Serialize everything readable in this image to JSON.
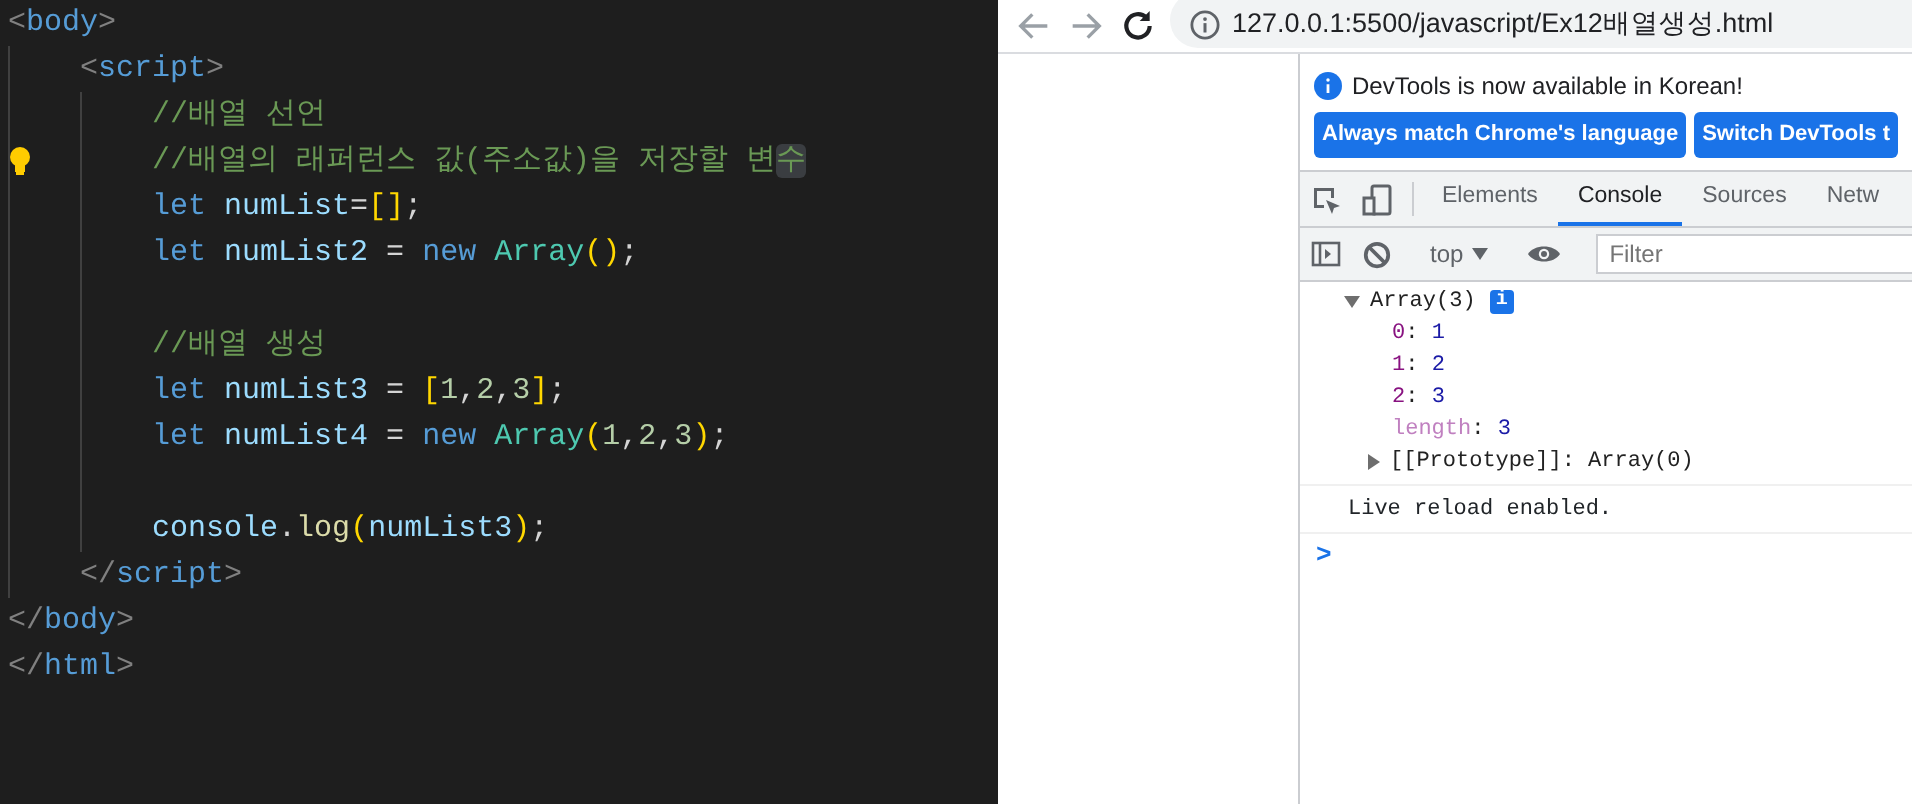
{
  "editor": {
    "lines": [
      {
        "lightbulb": false,
        "tokens": [
          {
            "text": "<",
            "kind": "tag-bracket"
          },
          {
            "text": "body",
            "kind": "tag"
          },
          {
            "text": ">",
            "kind": "tag-bracket"
          }
        ]
      },
      {
        "lightbulb": false,
        "tokens": [
          {
            "text": "    <",
            "kind": "tag-bracket"
          },
          {
            "text": "script",
            "kind": "tag"
          },
          {
            "text": ">",
            "kind": "tag-bracket"
          }
        ]
      },
      {
        "lightbulb": false,
        "tokens": [
          {
            "text": "        //배열 선언",
            "kind": "comment"
          }
        ]
      },
      {
        "lightbulb": true,
        "tokens": [
          {
            "text": "        //배열의 래퍼런스 값(주소값)을 저장할 변",
            "kind": "comment"
          },
          {
            "text": "수",
            "kind": "comment",
            "highlighted": true
          }
        ]
      },
      {
        "lightbulb": false,
        "tokens": [
          {
            "text": "        let",
            "kind": "keyword"
          },
          {
            "text": " numList",
            "kind": "variable"
          },
          {
            "text": "=",
            "kind": "operator"
          },
          {
            "text": "[]",
            "kind": "bracket"
          },
          {
            "text": ";",
            "kind": "operator"
          }
        ]
      },
      {
        "lightbulb": false,
        "tokens": [
          {
            "text": "        let",
            "kind": "keyword"
          },
          {
            "text": " numList2",
            "kind": "variable"
          },
          {
            "text": " = ",
            "kind": "operator"
          },
          {
            "text": "new",
            "kind": "keyword"
          },
          {
            "text": " Array",
            "kind": "class"
          },
          {
            "text": "()",
            "kind": "bracket"
          },
          {
            "text": ";",
            "kind": "operator"
          }
        ]
      },
      {
        "lightbulb": false
      },
      {
        "lightbulb": false,
        "tokens": [
          {
            "text": "        //배열 생성",
            "kind": "comment"
          }
        ]
      },
      {
        "lightbulb": false,
        "tokens": [
          {
            "text": "        let",
            "kind": "keyword"
          },
          {
            "text": " numList3",
            "kind": "variable"
          },
          {
            "text": " = ",
            "kind": "operator"
          },
          {
            "text": "[",
            "kind": "bracket"
          },
          {
            "text": "1",
            "kind": "number"
          },
          {
            "text": ",",
            "kind": "operator"
          },
          {
            "text": "2",
            "kind": "number"
          },
          {
            "text": ",",
            "kind": "operator"
          },
          {
            "text": "3",
            "kind": "number"
          },
          {
            "text": "]",
            "kind": "bracket"
          },
          {
            "text": ";",
            "kind": "operator"
          }
        ]
      },
      {
        "lightbulb": false,
        "tokens": [
          {
            "text": "        let",
            "kind": "keyword"
          },
          {
            "text": " numList4",
            "kind": "variable"
          },
          {
            "text": " = ",
            "kind": "operator"
          },
          {
            "text": "new",
            "kind": "keyword"
          },
          {
            "text": " Array",
            "kind": "class"
          },
          {
            "text": "(",
            "kind": "bracket"
          },
          {
            "text": "1",
            "kind": "number"
          },
          {
            "text": ",",
            "kind": "operator"
          },
          {
            "text": "2",
            "kind": "number"
          },
          {
            "text": ",",
            "kind": "operator"
          },
          {
            "text": "3",
            "kind": "number"
          },
          {
            "text": ")",
            "kind": "bracket"
          },
          {
            "text": ";",
            "kind": "operator"
          }
        ]
      },
      {
        "lightbulb": false
      },
      {
        "lightbulb": false,
        "tokens": [
          {
            "text": "        console",
            "kind": "variable"
          },
          {
            "text": ".",
            "kind": "operator"
          },
          {
            "text": "log",
            "kind": "function"
          },
          {
            "text": "(",
            "kind": "bracket"
          },
          {
            "text": "numList3",
            "kind": "variable"
          },
          {
            "text": ")",
            "kind": "bracket"
          },
          {
            "text": ";",
            "kind": "operator"
          }
        ]
      },
      {
        "lightbulb": false,
        "tokens": [
          {
            "text": "    </",
            "kind": "tag-bracket"
          },
          {
            "text": "script",
            "kind": "tag"
          },
          {
            "text": ">",
            "kind": "tag-bracket"
          }
        ]
      },
      {
        "lightbulb": false,
        "tokens": [
          {
            "text": "</",
            "kind": "tag-bracket"
          },
          {
            "text": "body",
            "kind": "tag"
          },
          {
            "text": ">",
            "kind": "tag-bracket"
          }
        ]
      },
      {
        "lightbulb": false,
        "tokens": [
          {
            "text": "</",
            "kind": "tag-bracket"
          },
          {
            "text": "html",
            "kind": "tag"
          },
          {
            "text": ">",
            "kind": "tag-bracket"
          }
        ]
      }
    ]
  },
  "browser": {
    "address": "127.0.0.1:5500/javascript/Ex12배열생성.html",
    "devtools": {
      "banner": {
        "message": "DevTools is now available in Korean!",
        "buttons": [
          "Always match Chrome's language",
          "Switch DevTools t"
        ]
      },
      "tabs": [
        {
          "label": "Elements",
          "selected": false
        },
        {
          "label": "Console",
          "selected": true
        },
        {
          "label": "Sources",
          "selected": false
        },
        {
          "label": "Netw",
          "selected": false
        }
      ],
      "context": "top",
      "filter": {
        "placeholder": "Filter"
      },
      "console": [
        {
          "kind": "object",
          "label": "Array(3)",
          "badge": "i",
          "expanded": true,
          "children": [
            {
              "kind": "index",
              "key": "0",
              "colon": ":",
              "value": "1"
            },
            {
              "kind": "index",
              "key": "1",
              "colon": ":",
              "value": "2"
            },
            {
              "kind": "index",
              "key": "2",
              "colon": ":",
              "value": "3"
            },
            {
              "kind": "meta",
              "key": "length",
              "colon": ":",
              "value": "3"
            },
            {
              "kind": "proto",
              "key": "[[Prototype]]",
              "colon": ":",
              "value": "Array(0)",
              "expanded": false
            }
          ]
        },
        {
          "kind": "log",
          "text": "Live reload enabled."
        }
      ],
      "prompt": ">"
    }
  }
}
